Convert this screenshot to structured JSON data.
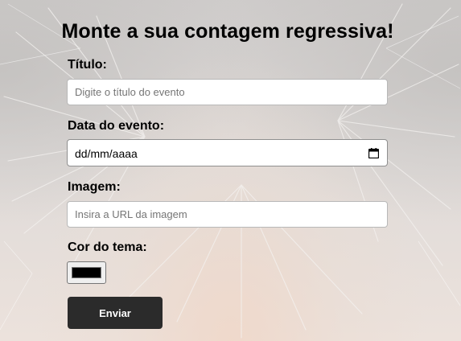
{
  "page": {
    "title": "Monte a sua contagem regressiva!"
  },
  "form": {
    "title_label": "Título:",
    "title_placeholder": "Digite o título do evento",
    "date_label": "Data do evento:",
    "date_value": "dd/mm/aaaa",
    "image_label": "Imagem:",
    "image_placeholder": "Insira a URL da imagem",
    "color_label": "Cor do tema:",
    "color_value": "#000000",
    "submit_label": "Enviar"
  },
  "icons": {
    "date_picker": "calendar-icon"
  },
  "colors": {
    "button_bg": "#2b2b2b",
    "button_text": "#ffffff",
    "text": "#000000"
  }
}
